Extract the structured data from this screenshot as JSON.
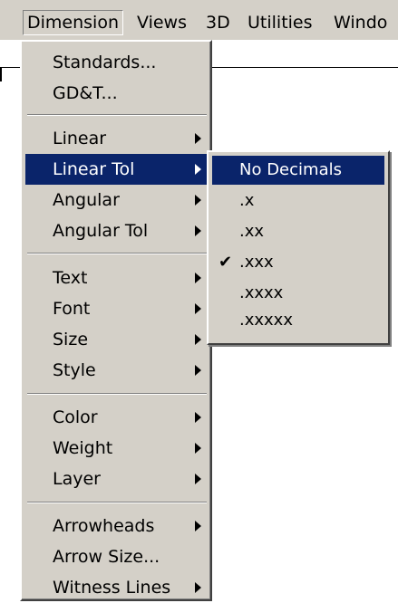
{
  "menubar": {
    "items": [
      {
        "label": "Dimension"
      },
      {
        "label": "Views"
      },
      {
        "label": "3D"
      },
      {
        "label": "Utilities"
      },
      {
        "label": "Windo"
      }
    ]
  },
  "dimension_menu": {
    "items": [
      {
        "label": "Standards..."
      },
      {
        "label": "GD&T..."
      },
      {
        "label": "Linear"
      },
      {
        "label": "Linear Tol"
      },
      {
        "label": "Angular"
      },
      {
        "label": "Angular Tol"
      },
      {
        "label": "Text"
      },
      {
        "label": "Font"
      },
      {
        "label": "Size"
      },
      {
        "label": "Style"
      },
      {
        "label": "Color"
      },
      {
        "label": "Weight"
      },
      {
        "label": "Layer"
      },
      {
        "label": "Arrowheads"
      },
      {
        "label": "Arrow Size..."
      },
      {
        "label": "Witness Lines"
      }
    ]
  },
  "linear_tol_submenu": {
    "checked": ".xxx",
    "items": [
      {
        "label": "No Decimals"
      },
      {
        "label": ".x"
      },
      {
        "label": ".xx"
      },
      {
        "label": ".xxx"
      },
      {
        "label": ".xxxx"
      },
      {
        "label": ".xxxxx"
      }
    ]
  },
  "colors": {
    "menu_face": "#d4d0c8",
    "highlight": "#0a246a"
  }
}
